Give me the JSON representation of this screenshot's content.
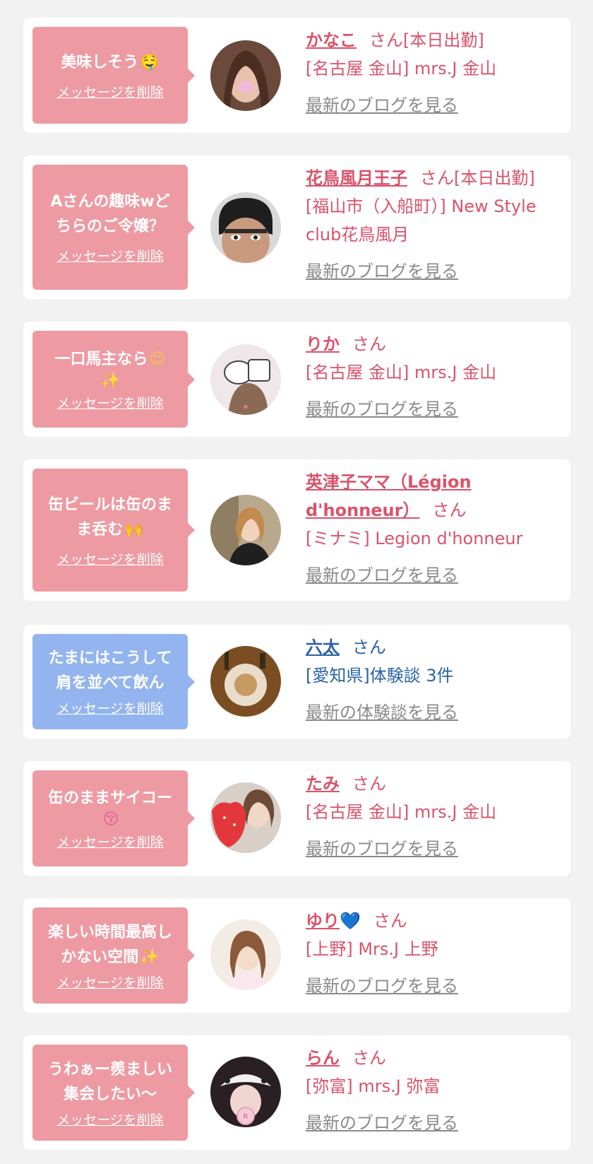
{
  "colors": {
    "pink": "#ee9aa3",
    "blue": "#93b4ef",
    "name_pink": "#d9536b",
    "name_blue": "#2a62a8",
    "link_gray": "#8a8a8a"
  },
  "cards": [
    {
      "bubble_lines": [
        "美味しそう"
      ],
      "bubble_emoji": "🤤",
      "delete_label": "メッセージを削除",
      "name": "かなこ",
      "suffix": "さん[本日出勤]",
      "shop_lines": [
        "[名古屋 金山] mrs.J 金山"
      ],
      "link": "最新のブログを見る"
    },
    {
      "bubble_lines": [
        "Aさんの趣味wど",
        "ちらのご令嬢？"
      ],
      "bubble_emoji": "",
      "delete_label": "メッセージを削除",
      "name": "花鳥風月王子",
      "suffix": "さん[本日出勤]",
      "shop_lines": [
        "[福山市（入船町）] New Style",
        "club花鳥風月"
      ],
      "link": "最新のブログを見る"
    },
    {
      "bubble_lines": [
        "一口馬主なら"
      ],
      "bubble_emoji": "☺",
      "bubble_emoji2": "✨",
      "delete_label": "メッセージを削除",
      "name": "りか",
      "suffix": "さん",
      "shop_lines": [
        "[名古屋 金山] mrs.J 金山"
      ],
      "link": "最新のブログを見る"
    },
    {
      "bubble_lines": [
        "缶ビールは缶のま",
        "ま呑む"
      ],
      "bubble_emoji": "🙌",
      "delete_label": "メッセージを削除",
      "name": "英津子ママ（Légion d'honneur）",
      "suffix": "さん",
      "shop_lines": [
        "[ミナミ] Legion d'honneur"
      ],
      "link": "最新のブログを見る"
    },
    {
      "bubble_lines": [
        "たまにはこうして",
        "肩を並べて飲ん"
      ],
      "bubble_emoji": "",
      "delete_label": "メッセージを削除",
      "name": "六太",
      "suffix": "さん",
      "shop_lines": [
        "[愛知県]体験談 3件"
      ],
      "link": "最新の体験談を見る",
      "variant": "blue"
    },
    {
      "bubble_lines": [
        "缶のままサイコー"
      ],
      "bubble_emoji": "",
      "bubble_emoji2": "😚",
      "delete_label": "メッセージを削除",
      "name": "たみ",
      "suffix": "さん",
      "shop_lines": [
        "[名古屋 金山] mrs.J 金山"
      ],
      "link": "最新のブログを見る"
    },
    {
      "bubble_lines": [
        "楽しい時間最高し",
        "かない空間"
      ],
      "bubble_emoji": "✨",
      "delete_label": "メッセージを削除",
      "name": "ゆり",
      "name_emoji": "💙",
      "suffix": "さん",
      "shop_lines": [
        "[上野] Mrs.J 上野"
      ],
      "link": "最新のブログを見る"
    },
    {
      "bubble_lines": [
        "うわぁー羨ましい",
        "集会したい〜"
      ],
      "bubble_emoji": "",
      "delete_label": "メッセージを削除",
      "name": "らん",
      "suffix": "さん",
      "shop_lines": [
        "[弥富] mrs.J 弥富"
      ],
      "link": "最新のブログを見る"
    }
  ]
}
